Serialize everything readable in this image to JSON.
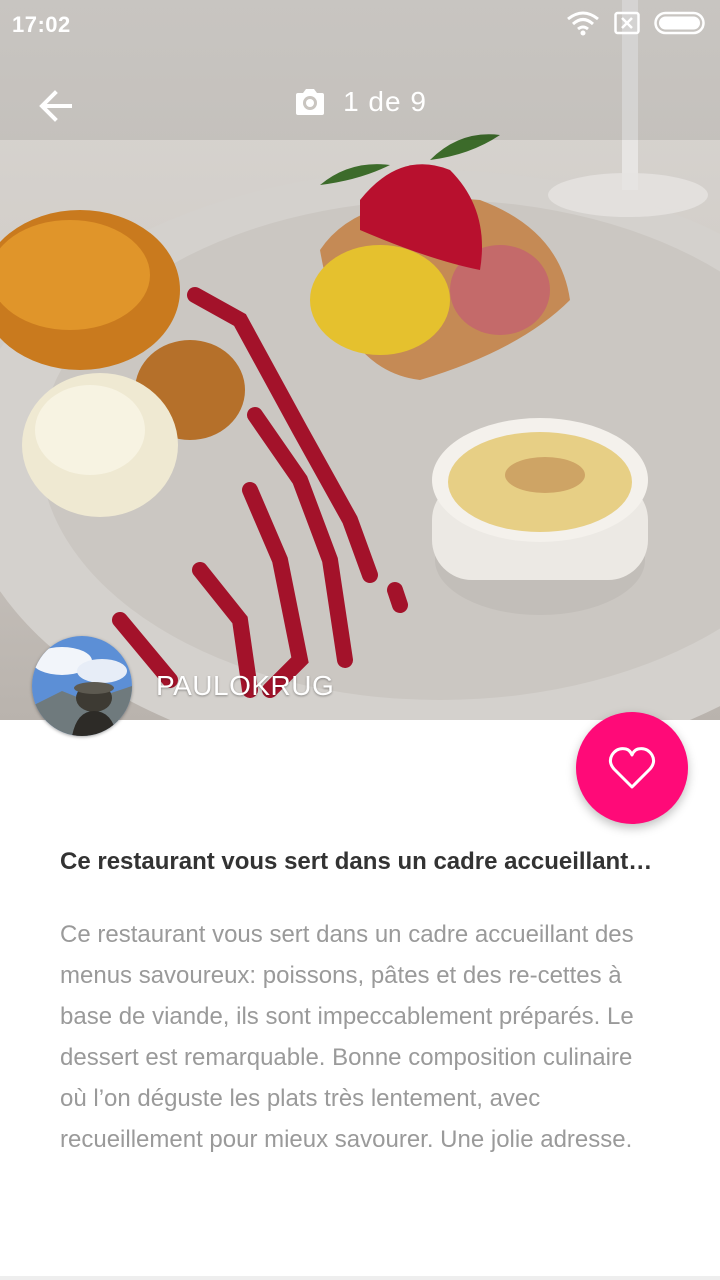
{
  "status_bar": {
    "time": "17:02",
    "icons": [
      "wifi-icon",
      "sim-icon",
      "battery-icon"
    ]
  },
  "top_bar": {
    "back_icon": "arrow-left-icon",
    "camera_icon": "camera-icon",
    "photo_counter": "1 de 9"
  },
  "author": {
    "name": "PAULOKRUG"
  },
  "like_button": {
    "icon": "heart-outline-icon",
    "color": "#ff0a78"
  },
  "review": {
    "title": "Ce restaurant vous sert dans un cadre accueillant…",
    "body": "Ce restaurant vous sert dans un cadre accueillant des menus savoureux: poissons, pâtes et des re-cettes à base de viande, ils sont impeccablement préparés. Le dessert est remarquable. Bonne composition culinaire où l’on déguste les plats très lentement, avec recueillement pour mieux savourer. Une jolie adresse."
  }
}
